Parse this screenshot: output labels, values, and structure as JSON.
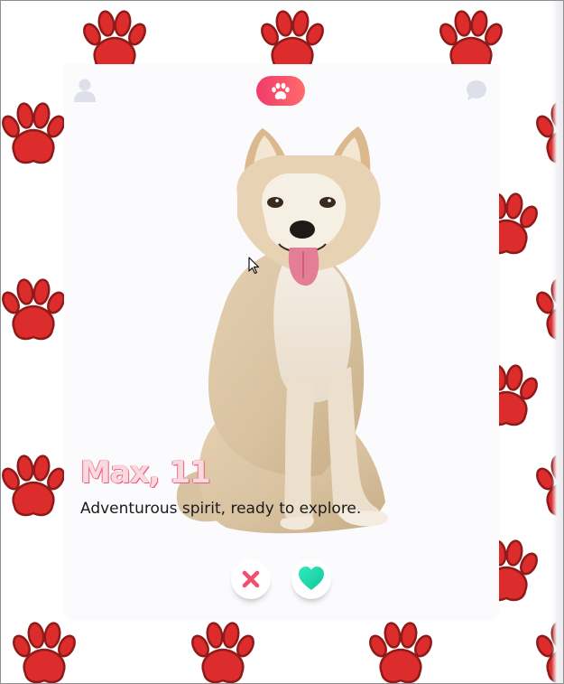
{
  "pet": {
    "name_age": "Max, 11",
    "bio": "Adventurous spirit, ready to explore."
  },
  "nav": {
    "profile_icon": "user-icon",
    "center_icon": "paw-icon",
    "chat_icon": "chat-bubble-icon"
  },
  "actions": {
    "dislike_icon": "x-icon",
    "like_icon": "heart-icon"
  },
  "colors": {
    "accent_start": "#f23a6b",
    "accent_end": "#ff6c6c",
    "dislike": "#f0506e",
    "like": "#2de5b7",
    "paw_pattern": "#dd2c2c",
    "name_tint": "#f7d9df"
  }
}
